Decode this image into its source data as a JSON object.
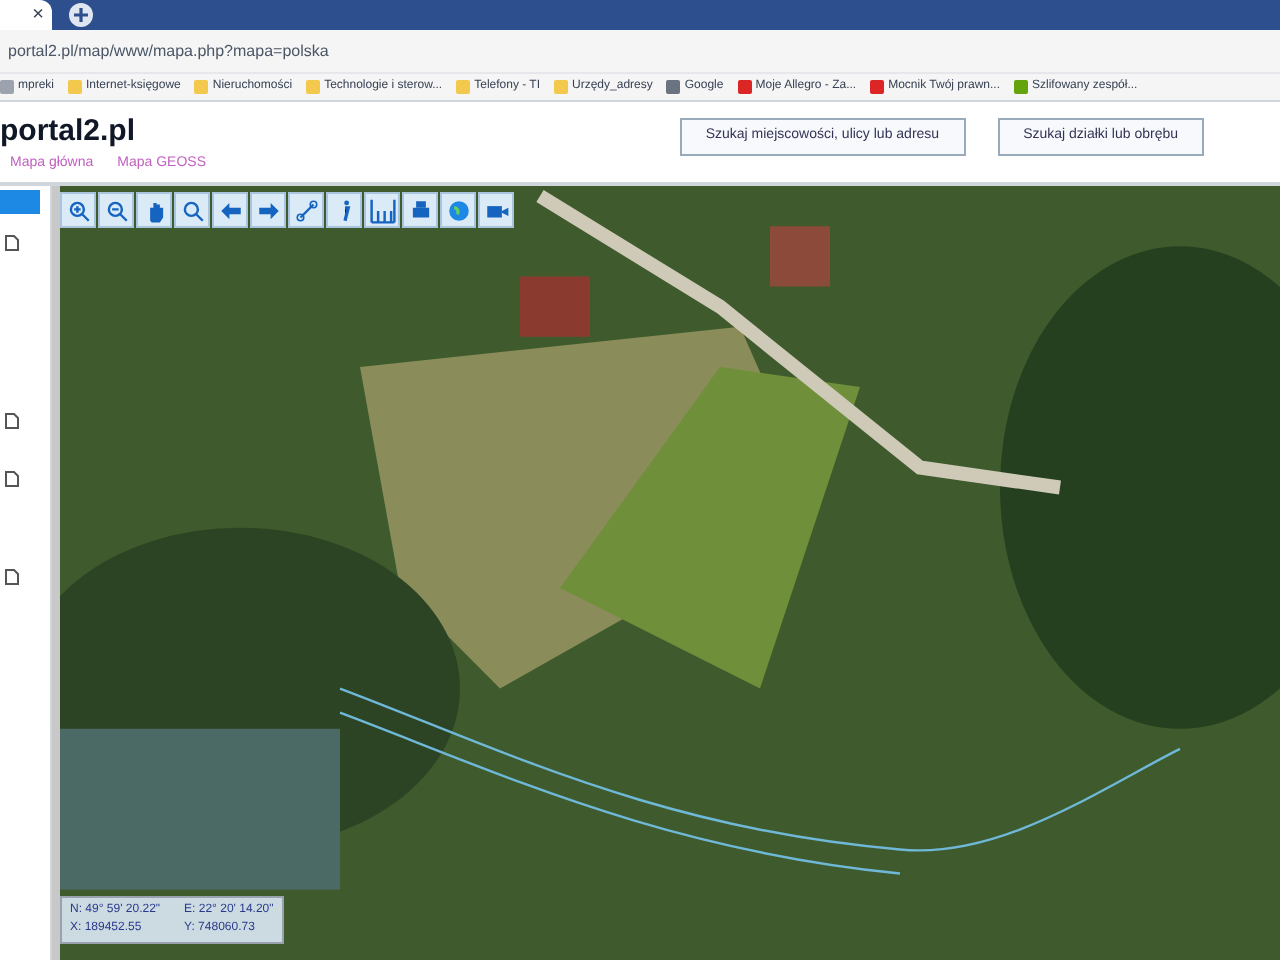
{
  "browser": {
    "tab_close": "×",
    "address": "portal2.pl/map/www/mapa.php?mapa=polska",
    "bookmarks": [
      {
        "label": "mpreki",
        "color": "#9ca3af"
      },
      {
        "label": "Internet-księgowe",
        "color": "#f2c94c"
      },
      {
        "label": "Nieruchomości",
        "color": "#f2c94c"
      },
      {
        "label": "Technologie i sterow...",
        "color": "#f2c94c"
      },
      {
        "label": "Telefony - TI",
        "color": "#f2c94c"
      },
      {
        "label": "Urzędy_adresy",
        "color": "#f2c94c"
      },
      {
        "label": "Google",
        "color": "#6b7280"
      },
      {
        "label": "Moje Allegro - Za...",
        "color": "#dc2626"
      },
      {
        "label": "Mocnik Twój prawn...",
        "color": "#dc2626"
      },
      {
        "label": "Szlifowany zespół...",
        "color": "#65a30d"
      }
    ]
  },
  "header": {
    "logo": "portal2.pl",
    "links": [
      "Mapa główna",
      "Mapa GEOSS"
    ],
    "buttons": [
      "Szukaj miejscowości, ulicy lub adresu",
      "Szukaj działki lub obrębu"
    ]
  },
  "coordinates": [
    {
      "label": "N:",
      "value": "49° 59' 20.22\""
    },
    {
      "label": "E:",
      "value": "22° 20' 14.20\""
    },
    {
      "label": "X:",
      "value": "189452.55"
    },
    {
      "label": "Y:",
      "value": "748060.73"
    }
  ]
}
